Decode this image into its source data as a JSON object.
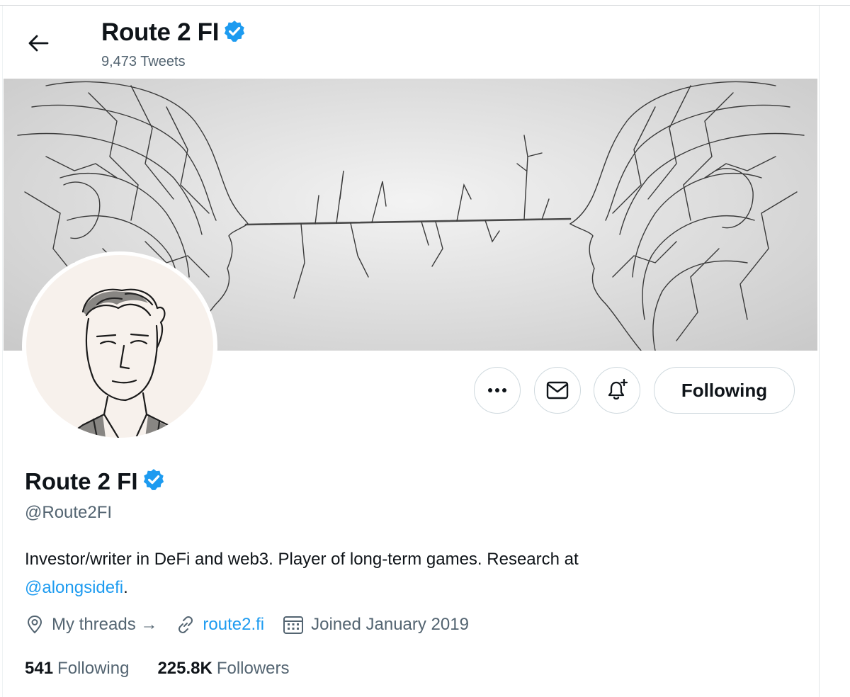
{
  "header": {
    "back_icon": "arrow-left-icon",
    "name": "Route 2 FI",
    "tweet_count": "9,473 Tweets",
    "verified_icon": "verified-badge-icon"
  },
  "banner": {
    "image": "two branch-wire faces connected by a twig"
  },
  "avatar": {
    "image": "sketched portrait of a man"
  },
  "actions": {
    "more_icon": "more-dots-icon",
    "message_icon": "mail-icon",
    "notify_icon": "bell-plus-icon",
    "follow_label": "Following"
  },
  "profile": {
    "name": "Route 2 FI",
    "handle": "@Route2FI",
    "bio_text": "Investor/writer in DeFi and web3. Player of long-term games. Research at",
    "bio_mention": "@alongsidefi",
    "bio_end": ".",
    "location_icon": "location-pin-icon",
    "location": "My threads →",
    "website_icon": "link-icon",
    "website": "route2.fi",
    "joined_icon": "calendar-icon",
    "joined": "Joined January 2019"
  },
  "stats": {
    "following_count": "541",
    "following_label": "Following",
    "followers_count": "225.8K",
    "followers_label": "Followers"
  },
  "colors": {
    "accent": "#1d9bf0",
    "text_primary": "#0f1419",
    "text_secondary": "#536471",
    "border": "#cfd9de"
  }
}
